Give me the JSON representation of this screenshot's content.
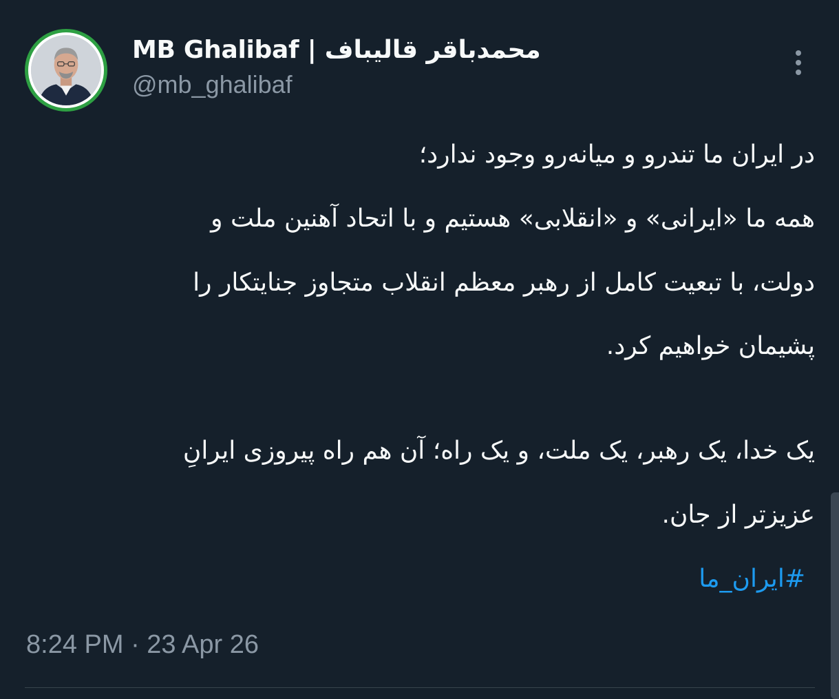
{
  "author": {
    "display_name": "MB Ghalibaf | محمدباقر قالیباف",
    "handle": "@mb_ghalibaf",
    "avatar_icon": "profile-photo"
  },
  "tweet": {
    "lines": [
      "در ایران ما تندرو و میانه‌رو وجود ندارد؛",
      "همه ما «ایرانی» و «انقلابی» هستیم و با اتحاد آهنین ملت و",
      "دولت، با تبعیت کامل از رهبر معظم انقلاب متجاوز جنایتکار را",
      "پشیمان خواهیم کرد.",
      "یک خدا، یک رهبر، یک ملت، و یک راه؛ آن هم راه پیروزی ایرانِ",
      "عزیزتر از جان."
    ],
    "hashtag": "#ایران_ما",
    "timestamp": "8:24 PM · 23 Apr 26"
  },
  "icons": {
    "more": "more-options-icon"
  },
  "colors": {
    "background": "#15202b",
    "text": "#f7f9f9",
    "secondary": "#8b98a5",
    "link": "#1d9bf0",
    "avatar_ring": "#2ea043"
  }
}
